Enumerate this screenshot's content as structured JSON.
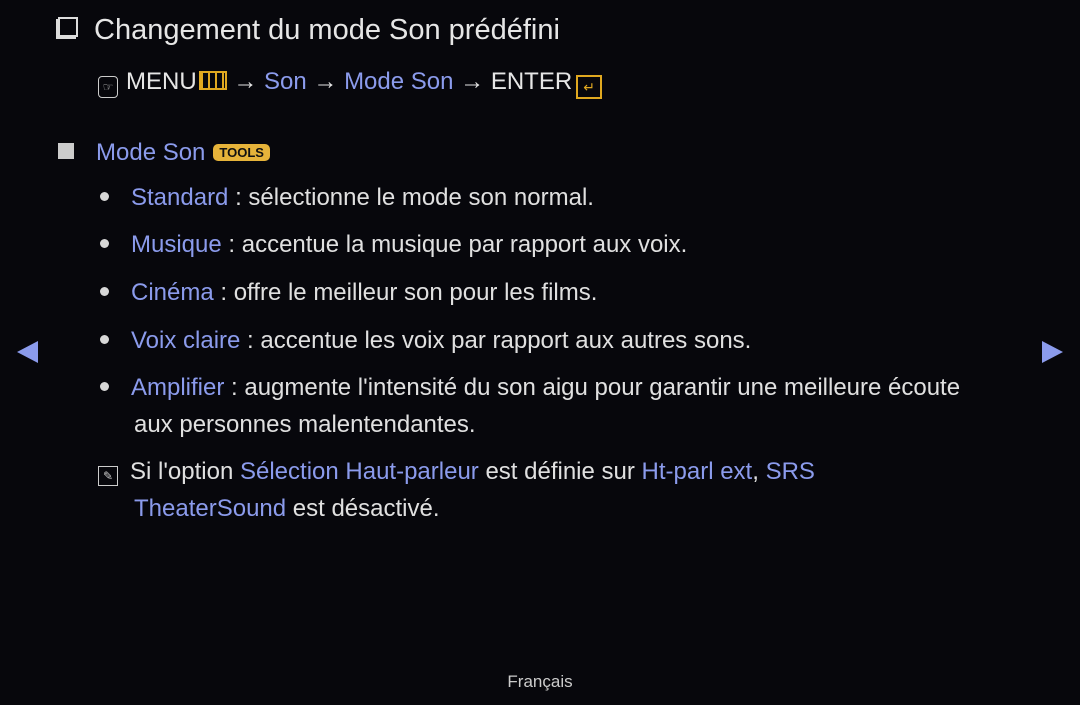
{
  "title": "Changement du mode Son prédéfini",
  "path": {
    "menu": "MENU",
    "arrow": "→",
    "son": "Son",
    "mode_son": "Mode Son",
    "enter": "ENTER"
  },
  "section": {
    "label": "Mode Son",
    "tools_badge": "TOOLS"
  },
  "items": [
    {
      "name": "Standard",
      "desc": " : sélectionne le mode son normal."
    },
    {
      "name": "Musique",
      "desc": " : accentue la musique par rapport aux voix."
    },
    {
      "name": "Cinéma",
      "desc": " : offre le meilleur son pour les films."
    },
    {
      "name": "Voix claire",
      "desc": " : accentue les voix par rapport aux autres sons."
    },
    {
      "name": "Amplifier",
      "desc": " : augmente l'intensité du son aigu pour garantir une meilleure écoute",
      "desc2": "aux personnes malentendantes."
    }
  ],
  "note": {
    "t1": "Si l'option ",
    "h1": "Sélection Haut-parleur",
    "t2": " est définie sur ",
    "h2": "Ht-parl ext",
    "t3": ", ",
    "h3": "SRS",
    "h4": "TheaterSound",
    "t4": " est désactivé."
  },
  "footer": "Français"
}
